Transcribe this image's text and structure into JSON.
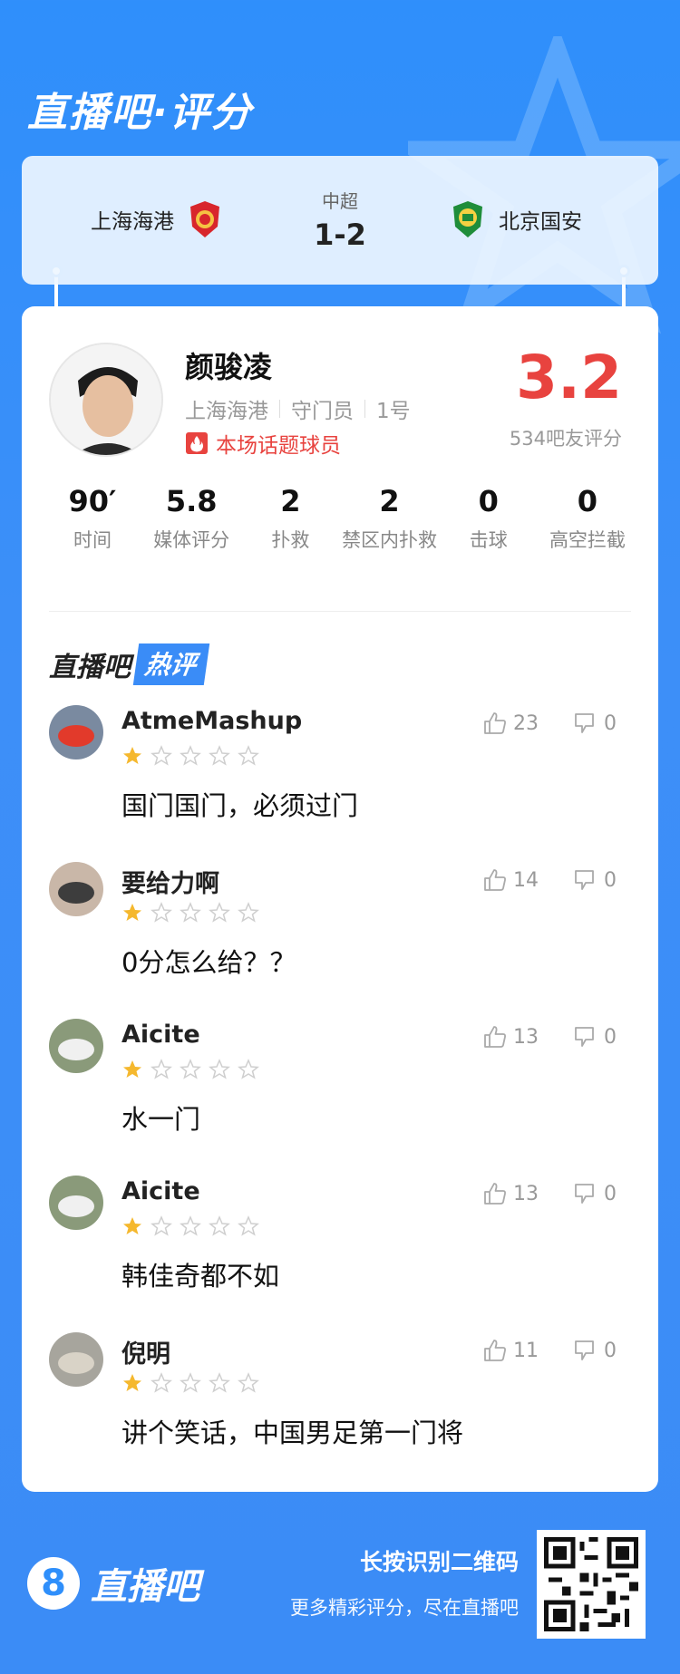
{
  "brand": {
    "title": "直播吧·评分"
  },
  "match": {
    "home_team": "上海海港",
    "away_team": "北京国安",
    "league": "中超",
    "score": "1-2"
  },
  "player": {
    "name": "颜骏凌",
    "team": "上海海港",
    "position": "守门员",
    "number": "1号",
    "topic_tag": "本场话题球员",
    "rating": "3.2",
    "rating_count": "534吧友评分"
  },
  "stats": [
    {
      "value": "90′",
      "label": "时间"
    },
    {
      "value": "5.8",
      "label": "媒体评分"
    },
    {
      "value": "2",
      "label": "扑救"
    },
    {
      "value": "2",
      "label": "禁区内扑救"
    },
    {
      "value": "0",
      "label": "击球"
    },
    {
      "value": "0",
      "label": "高空拦截"
    }
  ],
  "hot": {
    "title_a": "直播吧",
    "title_b": "热评"
  },
  "comments": [
    {
      "user": "AtmeMashup",
      "stars": 1,
      "likes": "23",
      "dislikes": "0",
      "text": "国门国门，必须过门"
    },
    {
      "user": "要给力啊",
      "stars": 1,
      "likes": "14",
      "dislikes": "0",
      "text": "0分怎么给？？"
    },
    {
      "user": "Aicite",
      "stars": 1,
      "likes": "13",
      "dislikes": "0",
      "text": "水一门"
    },
    {
      "user": "Aicite",
      "stars": 1,
      "likes": "13",
      "dislikes": "0",
      "text": "韩佳奇都不如"
    },
    {
      "user": "倪明",
      "stars": 1,
      "likes": "11",
      "dislikes": "0",
      "text": "讲个笑话，中国男足第一门将"
    }
  ],
  "footer": {
    "logo_digit": "8",
    "logo_word": "直播吧",
    "cta_title": "长按识别二维码",
    "cta_sub": "更多精彩评分，尽在直播吧"
  },
  "colors": {
    "accent": "#2f8ffb",
    "rating_red": "#e8433f",
    "star_gold": "#f5b82e",
    "star_empty": "#cfcfcf"
  }
}
